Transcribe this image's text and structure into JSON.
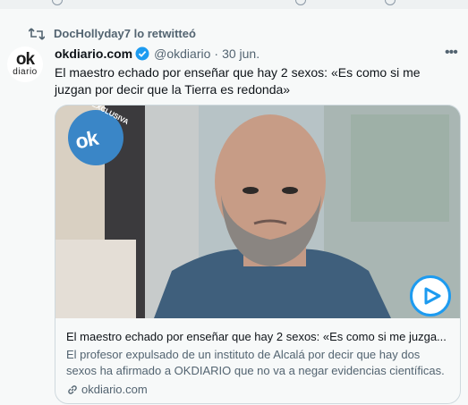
{
  "retweet": {
    "label": "DocHollyday7 lo retwitteó"
  },
  "tweet": {
    "avatar": {
      "logo_ok": "ok",
      "logo_diario": "diario"
    },
    "display_name": "okdiario.com",
    "handle": "@okdiario",
    "separator": "·",
    "date": "30 jun.",
    "more": "•••",
    "text": "El maestro echado por enseñar que hay 2 sexos: «Es como si me juzgan por decir que la Tierra es redonda»"
  },
  "card": {
    "badge_logo": "ok",
    "badge_label": "EXCLUSIVA",
    "title": "El maestro echado por enseñar que hay 2 sexos: «Es como si me juzga...",
    "description": "El profesor expulsado de un instituto de Alcalá por decir que hay dos sexos ha afirmado a OKDIARIO que no va a negar evidencias científicas.",
    "domain": "okdiario.com"
  },
  "colors": {
    "accent": "#1d9bf0",
    "muted": "#536471",
    "border": "#cfd9de"
  },
  "icons": [
    "retweet-icon",
    "verified-badge-icon",
    "more-icon",
    "play-icon",
    "link-icon"
  ]
}
